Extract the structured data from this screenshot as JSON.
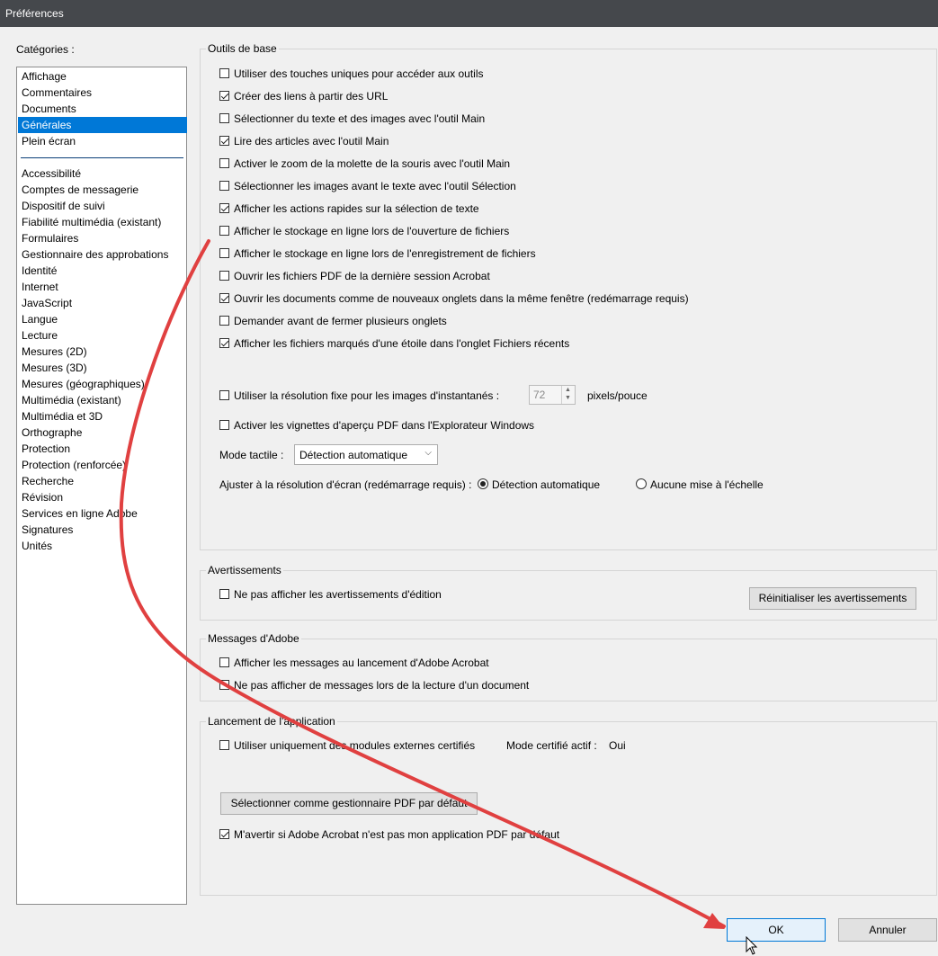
{
  "window": {
    "title": "Préférences"
  },
  "categories": {
    "label": "Catégories :",
    "top_items": [
      {
        "label": "Affichage"
      },
      {
        "label": "Commentaires"
      },
      {
        "label": "Documents"
      },
      {
        "label": "Générales",
        "selected": true
      },
      {
        "label": "Plein écran"
      }
    ],
    "items": [
      {
        "label": "Accessibilité"
      },
      {
        "label": "Comptes de messagerie"
      },
      {
        "label": "Dispositif de suivi"
      },
      {
        "label": "Fiabilité multimédia (existant)"
      },
      {
        "label": "Formulaires"
      },
      {
        "label": "Gestionnaire des approbations"
      },
      {
        "label": "Identité"
      },
      {
        "label": "Internet"
      },
      {
        "label": "JavaScript"
      },
      {
        "label": "Langue"
      },
      {
        "label": "Lecture"
      },
      {
        "label": "Mesures (2D)"
      },
      {
        "label": "Mesures (3D)"
      },
      {
        "label": "Mesures (géographiques)"
      },
      {
        "label": "Multimédia (existant)"
      },
      {
        "label": "Multimédia et 3D"
      },
      {
        "label": "Orthographe"
      },
      {
        "label": "Protection"
      },
      {
        "label": "Protection (renforcée)"
      },
      {
        "label": "Recherche"
      },
      {
        "label": "Révision"
      },
      {
        "label": "Services en ligne Adobe"
      },
      {
        "label": "Signatures"
      },
      {
        "label": "Unités"
      }
    ]
  },
  "basic_tools": {
    "title": "Outils de base",
    "options": [
      {
        "label": "Utiliser des touches uniques pour accéder aux outils",
        "checked": false
      },
      {
        "label": "Créer des liens à partir des URL",
        "checked": true
      },
      {
        "label": "Sélectionner du texte et des images avec l'outil Main",
        "checked": false
      },
      {
        "label": "Lire des articles avec l'outil Main",
        "checked": true
      },
      {
        "label": "Activer le zoom de la molette de la souris avec l'outil Main",
        "checked": false
      },
      {
        "label": "Sélectionner les images avant le texte avec l'outil Sélection",
        "checked": false
      },
      {
        "label": "Afficher les actions rapides sur la sélection de texte",
        "checked": true
      },
      {
        "label": "Afficher le stockage en ligne lors de l'ouverture de fichiers",
        "checked": false
      },
      {
        "label": "Afficher le stockage en ligne lors de l'enregistrement de fichiers",
        "checked": false
      },
      {
        "label": "Ouvrir les fichiers PDF de la dernière session Acrobat",
        "checked": false
      },
      {
        "label": "Ouvrir les documents comme de nouveaux onglets dans la même fenêtre (redémarrage requis)",
        "checked": true
      },
      {
        "label": "Demander avant de fermer plusieurs onglets",
        "checked": false
      },
      {
        "label": "Afficher les fichiers marqués d'une étoile dans l'onglet Fichiers récents",
        "checked": true
      }
    ],
    "fixed_resolution": {
      "label": "Utiliser la résolution fixe pour les images d'instantanés :",
      "checked": false,
      "value": "72",
      "unit": "pixels/pouce"
    },
    "thumbnails": {
      "label": "Activer les vignettes d'aperçu PDF dans l'Explorateur Windows",
      "checked": false
    },
    "touch_mode": {
      "label": "Mode tactile :",
      "value": "Détection automatique"
    },
    "screen_resolution": {
      "label": "Ajuster à la résolution d'écran (redémarrage requis) :",
      "options": [
        {
          "label": "Détection automatique",
          "selected": true
        },
        {
          "label": "Aucune mise à l'échelle",
          "selected": false
        }
      ]
    }
  },
  "warnings": {
    "title": "Avertissements",
    "option": {
      "label": "Ne pas afficher les avertissements d'édition",
      "checked": false
    },
    "reset_label": "Réinitialiser les avertissements"
  },
  "adobe_messages": {
    "title": "Messages d'Adobe",
    "options": [
      {
        "label": "Afficher les messages au lancement d'Adobe Acrobat",
        "checked": false
      },
      {
        "label": "Ne pas afficher de messages lors de la lecture d'un document",
        "checked": false
      }
    ]
  },
  "app_launch": {
    "title": "Lancement de l'application",
    "certified": {
      "label": "Utiliser uniquement des modules externes certifiés",
      "checked": false
    },
    "certified_mode_label": "Mode certifié actif :",
    "certified_mode_value": "Oui",
    "default_handler_label": "Sélectionner comme gestionnaire PDF par défaut",
    "warn_default": {
      "label": "M'avertir si Adobe Acrobat n'est pas mon application PDF par défaut",
      "checked": true
    }
  },
  "footer": {
    "ok_label": "OK",
    "cancel_label": "Annuler"
  },
  "colors": {
    "selection": "#0078d7",
    "titlebar": "#45484c",
    "annotation_arrow": "#e04040"
  }
}
